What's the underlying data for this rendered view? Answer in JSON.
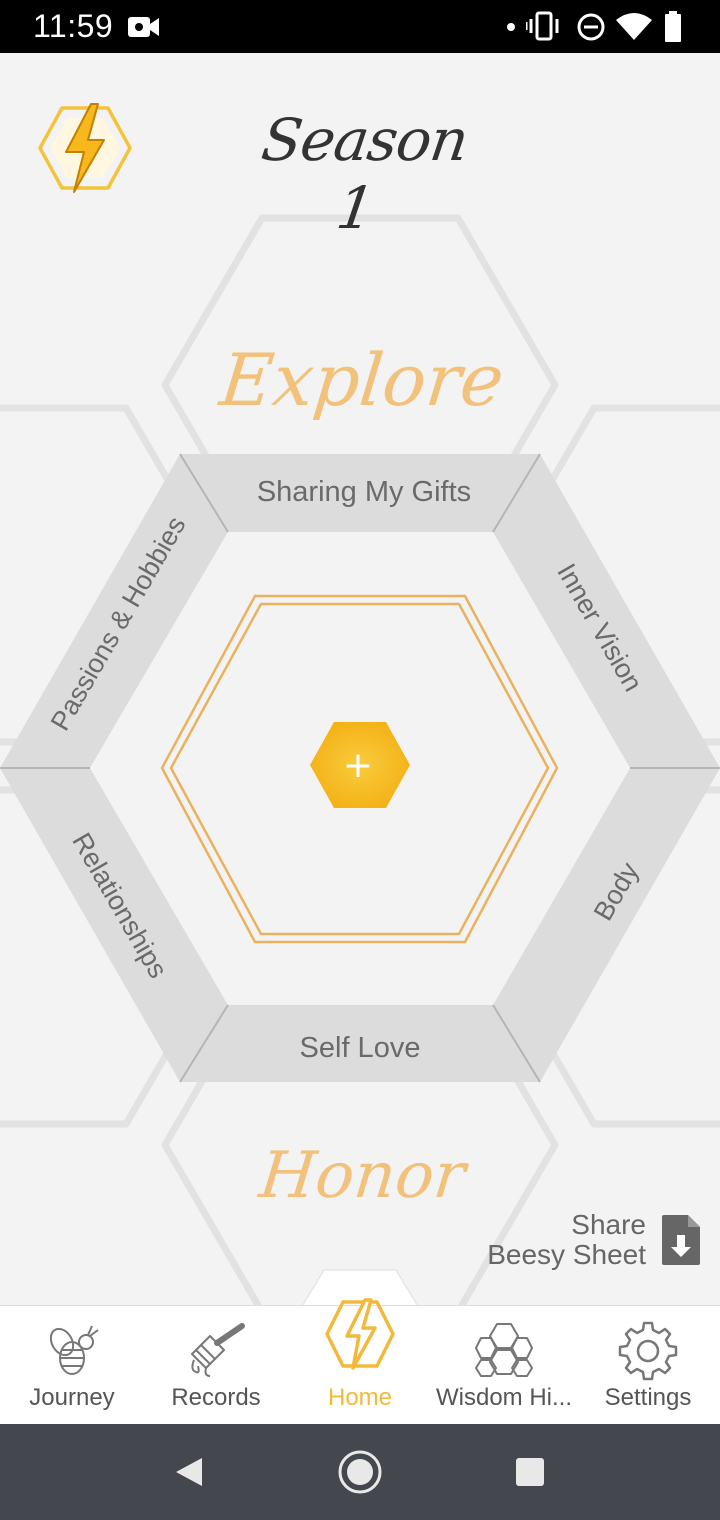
{
  "status_bar": {
    "time": "11:59",
    "icons": [
      "video-camera-icon",
      "notification-dot-icon",
      "vibrate-icon",
      "do-not-disturb-icon",
      "wifi-icon",
      "battery-icon"
    ]
  },
  "header": {
    "title": "Season 1",
    "logo_icon": "bee-lightning-hex-icon"
  },
  "honeycomb": {
    "top_label": "Explore",
    "bottom_label": "Honor",
    "segments": {
      "top": "Sharing My Gifts",
      "upper_left": "Passions & Hobbies",
      "upper_right": "Inner Vision",
      "lower_left": "Relationships",
      "lower_right": "Body",
      "bottom": "Self Love"
    },
    "center_button": "+"
  },
  "share": {
    "line1": "Share",
    "line2": "Beesy Sheet",
    "icon": "file-download-icon"
  },
  "bottom_nav": {
    "items": [
      {
        "label": "Journey",
        "icon": "bee-icon"
      },
      {
        "label": "Records",
        "icon": "honey-dipper-icon"
      },
      {
        "label": "Home",
        "icon": "lightning-hex-icon",
        "active": true
      },
      {
        "label": "Wisdom Hi...",
        "icon": "honeycomb-icon"
      },
      {
        "label": "Settings",
        "icon": "gear-icon"
      }
    ]
  },
  "system_nav": {
    "icons": [
      "back-icon",
      "home-circle-icon",
      "recents-icon"
    ]
  },
  "colors": {
    "accent": "#f3b93a",
    "accent_light": "#f2c27c",
    "segment": "#dcdcdc",
    "background": "#f3f3f3"
  }
}
